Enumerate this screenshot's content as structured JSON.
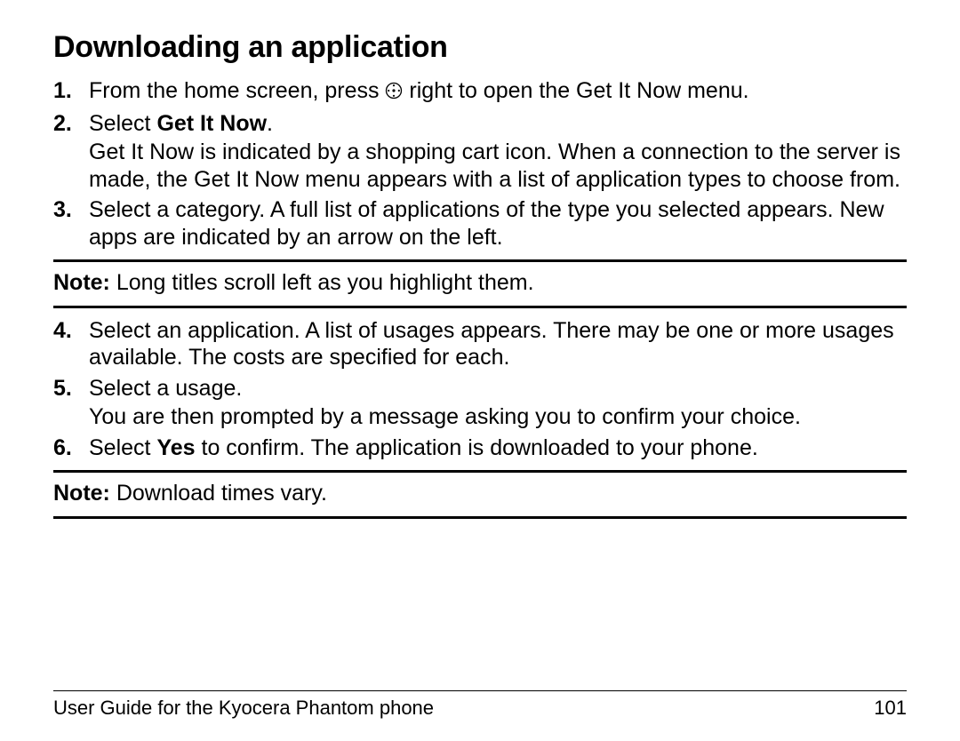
{
  "heading": "Downloading an application",
  "steps": {
    "s1": {
      "num": "1.",
      "pre": "From the home screen, press ",
      "post": " right to open the Get It Now menu."
    },
    "s2": {
      "num": "2.",
      "lead": "Select ",
      "bold": "Get It Now",
      "tail": ".",
      "desc": "Get It Now is indicated by a shopping cart icon. When a connection to the server is made, the Get It Now menu appears with a list of application types to choose from."
    },
    "s3": {
      "num": "3.",
      "text": "Select a category. A full list of applications of the type you selected appears. New apps are indicated by an arrow on the left."
    },
    "s4": {
      "num": "4.",
      "text": "Select an application. A list of usages appears. There may be one or more usages available. The costs are specified for each."
    },
    "s5": {
      "num": "5.",
      "text": "Select a usage.",
      "desc": "You are then prompted by a message asking you to confirm your choice."
    },
    "s6": {
      "num": "6.",
      "lead": "Select ",
      "bold": "Yes",
      "tail": " to confirm. The application is downloaded to your phone."
    }
  },
  "note1": {
    "label": "Note:",
    "text": " Long titles scroll left as you highlight them."
  },
  "note2": {
    "label": "Note:",
    "text": " Download times vary."
  },
  "footer": {
    "left": "User Guide for the Kyocera Phantom phone",
    "right": "101"
  }
}
